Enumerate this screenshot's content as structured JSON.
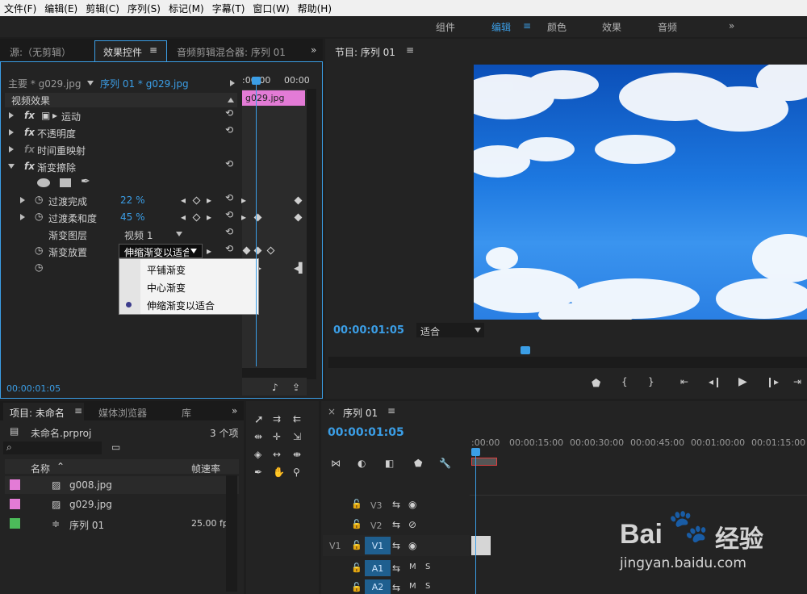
{
  "menu": [
    "文件(F)",
    "编辑(E)",
    "剪辑(C)",
    "序列(S)",
    "标记(M)",
    "字幕(T)",
    "窗口(W)",
    "帮助(H)"
  ],
  "workspaces": {
    "assembly": "组件",
    "editing": "编辑",
    "color": "颜色",
    "effects": "效果",
    "audio": "音频",
    "more": "»"
  },
  "effects_panel": {
    "tab_source": "源:（无剪辑）",
    "tab_effect_controls": "效果控件",
    "tab_audio_mixer": "音频剪辑混合器: 序列 01",
    "master_clip": "主要 * g029.jpg",
    "sequence_clip": "序列 01 * g029.jpg",
    "ruler_start": ":00:00",
    "ruler_end": "00:00",
    "clip_bar": "g029.jpg",
    "video_effects": "视频效果",
    "motion": "运动",
    "opacity": "不透明度",
    "time_remap": "时间重映射",
    "gradient_wipe": "渐变擦除",
    "transition_completion": "过渡完成",
    "transition_completion_value": "22 %",
    "transition_softness": "过渡柔和度",
    "transition_softness_value": "45 %",
    "gradient_layer": "渐变图层",
    "gradient_layer_value": "视频 1",
    "gradient_placement": "渐变放置",
    "gradient_placement_value": "伸缩渐变以适合",
    "dropdown_options": [
      "平铺渐变",
      "中心渐变",
      "伸缩渐变以适合"
    ],
    "timecode": "00:00:01:05"
  },
  "program": {
    "title": "节目: 序列 01",
    "timecode": "00:00:01:05",
    "fit": "适合"
  },
  "project": {
    "tab_project": "项目: 未命名",
    "tab_media_browser": "媒体浏览器",
    "tab_library": "库",
    "file": "未命名.prproj",
    "item_count": "3 个项",
    "col_name": "名称",
    "col_fps": "帧速率",
    "items": [
      {
        "name": "g008.jpg",
        "fps": "",
        "color": "#e37bd6"
      },
      {
        "name": "g029.jpg",
        "fps": "",
        "color": "#e37bd6"
      },
      {
        "name": "序列 01",
        "fps": "25.00 fp",
        "color": "#4cbb5a"
      }
    ]
  },
  "timeline": {
    "title": "序列 01",
    "timecode": "00:00:01:05",
    "ruler": [
      ":00:00",
      "00:00:15:00",
      "00:00:30:00",
      "00:00:45:00",
      "00:01:00:00",
      "00:01:15:00"
    ],
    "tracks": [
      {
        "name": "V3",
        "src": ""
      },
      {
        "name": "V2",
        "src": ""
      },
      {
        "name": "V1",
        "src": "V1"
      },
      {
        "name": "A1",
        "src": ""
      },
      {
        "name": "A2",
        "src": ""
      }
    ]
  },
  "watermark": {
    "brand": "Bai",
    "brand2": "经验",
    "url": "jingyan.baidu.com"
  }
}
